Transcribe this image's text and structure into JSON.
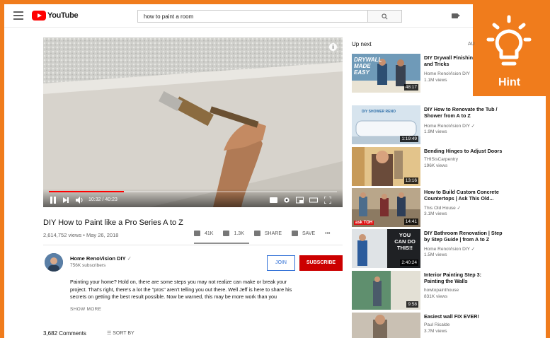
{
  "header": {
    "logo_text": "YouTube",
    "search_value": "how to paint a room",
    "search_icon": "magnifier"
  },
  "hint": {
    "label": "Hint",
    "icon": "lightbulb-icon"
  },
  "player": {
    "time": "10:32 / 40:23",
    "progress": 0.26,
    "buffered": 0.49
  },
  "video": {
    "title": "DIY How to Paint like a Pro Series A to Z",
    "meta": "2,614,752 views • May 26, 2018",
    "likes": "41K",
    "dislikes": "1.3K",
    "share": "SHARE",
    "save": "SAVE",
    "more": "•••"
  },
  "channel": {
    "name": "Home RenoVision DIY",
    "verified": "✓",
    "subs": "756K subscribers",
    "join": "JOIN",
    "subscribe": "SUBSCRIBE"
  },
  "description": {
    "line1": "Painting your home? Hold on, there are some steps you may not realize can make or break your",
    "line2": "project. That's right, there's a lot the \"pros\" aren't telling you out there. Well Jeff is here to share his",
    "line3": "secrets on getting the best result possible. Now be warned, this may be more work than you",
    "show_more": "SHOW MORE"
  },
  "comments": {
    "count": "3,682 Comments",
    "sort": "SORT BY"
  },
  "sidebar": {
    "up_next": "Up next",
    "autoplay": "AU",
    "items": [
      {
        "title_1": "DIY Drywall Finishin",
        "title_2": "and Tricks",
        "channel": "Home RenoVision DIY",
        "views": "1.1M views",
        "duration": "48:17",
        "thumb_text_1": "DRYWALL",
        "thumb_text_2": "MADE",
        "thumb_text_3": "EASY"
      },
      {
        "title_1": "DIY How to Renovate the Tub /",
        "title_2": "Shower from A to Z",
        "channel": "Home RenoVision DIY ✓",
        "views": "1.9M views",
        "duration": "1:19:49",
        "thumb_text_1": "DIY SHOWER RENO"
      },
      {
        "title_1": "Bending Hinges to Adjust Doors",
        "title_2": "",
        "channel": "THISisCarpentry",
        "views": "196K views",
        "duration": "13:16"
      },
      {
        "title_1": "How to Build Custom Concrete",
        "title_2": "Countertops | Ask This Old...",
        "channel": "This Old House ✓",
        "views": "3.1M views",
        "duration": "14:41",
        "thumb_text_1": "ask TOH"
      },
      {
        "title_1": "DIY Bathroom Renovation | Step",
        "title_2": "by Step Guide | from A to Z",
        "channel": "Home RenoVision DIY ✓",
        "views": "1.5M views",
        "duration": "2:40:24",
        "thumb_text_1": "YOU",
        "thumb_text_2": "CAN DO",
        "thumb_text_3": "THIS!!"
      },
      {
        "title_1": "Interior Painting Step 3:",
        "title_2": "Painting the Walls",
        "channel": "howtopainthouse",
        "views": "831K views",
        "duration": "9:58"
      },
      {
        "title_1": "Easiest wall FIX EVER!",
        "title_2": "",
        "channel": "Paul Ricalde",
        "views": "3.7M views",
        "duration": ""
      }
    ]
  }
}
